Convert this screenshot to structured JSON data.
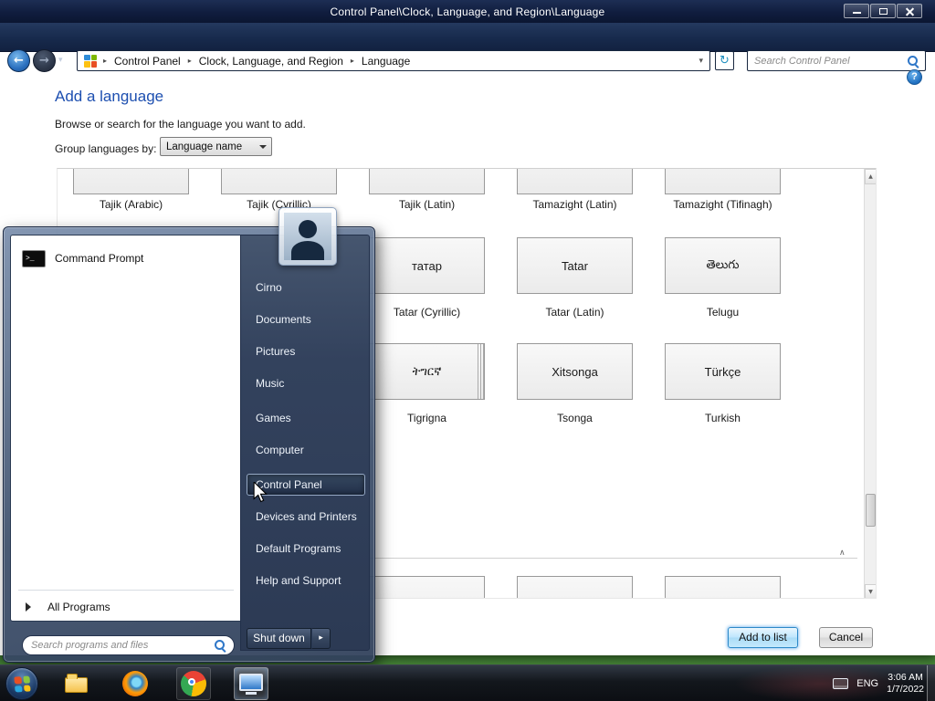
{
  "window": {
    "title": "Control Panel\\Clock, Language, and Region\\Language",
    "breadcrumb": [
      "Control Panel",
      "Clock, Language, and Region",
      "Language"
    ],
    "search_placeholder": "Search Control Panel"
  },
  "page": {
    "title": "Add a language",
    "subtitle": "Browse or search for the language you want to add.",
    "group_label": "Group languages by:",
    "group_value": "Language name",
    "add_button": "Add to list",
    "cancel_button": "Cancel"
  },
  "languages": {
    "tiles": [
      {
        "label": "Tajik (Arabic)",
        "text": ""
      },
      {
        "label": "Tajik (Cyrillic)",
        "text": ""
      },
      {
        "label": "Tajik (Latin)",
        "text": ""
      },
      {
        "label": "Tamazight (Latin)",
        "text": ""
      },
      {
        "label": "Tamazight (Tifinagh)",
        "text": ""
      },
      {
        "label": "Tatar (Cyrillic)",
        "text": "татар"
      },
      {
        "label": "Tatar (Latin)",
        "text": "Tatar"
      },
      {
        "label": "Telugu",
        "text": "తెలుగు"
      },
      {
        "label": "Tigrigna",
        "text": "ትግርኛ"
      },
      {
        "label": "Tsonga",
        "text": "Xitsonga"
      },
      {
        "label": "Turkish",
        "text": "Türkçe"
      }
    ]
  },
  "start_menu": {
    "pinned_app": "Command Prompt",
    "all_programs": "All Programs",
    "search_placeholder": "Search programs and files",
    "user": "Cirno",
    "items": [
      "Documents",
      "Pictures",
      "Music",
      "Games",
      "Computer",
      "Control Panel",
      "Devices and Printers",
      "Default Programs",
      "Help and Support"
    ],
    "shutdown": "Shut down"
  },
  "taskbar": {
    "language": "ENG",
    "time": "3:06 AM",
    "date": "1/7/2022"
  },
  "icons": {
    "back": "←",
    "forward": "→",
    "refresh": "↻",
    "dropdown": "▾",
    "crumb_sep": "▸",
    "help": "?",
    "scroll_up": "▲",
    "scroll_down": "▼",
    "collapse": "∧",
    "shutdown_arrow": "▸",
    "cmd_prompt": ">_"
  },
  "colors": {
    "accent_blue": "#2f8cd8",
    "heading_blue": "#1d4fb0",
    "menu_dark": "#33425d"
  }
}
